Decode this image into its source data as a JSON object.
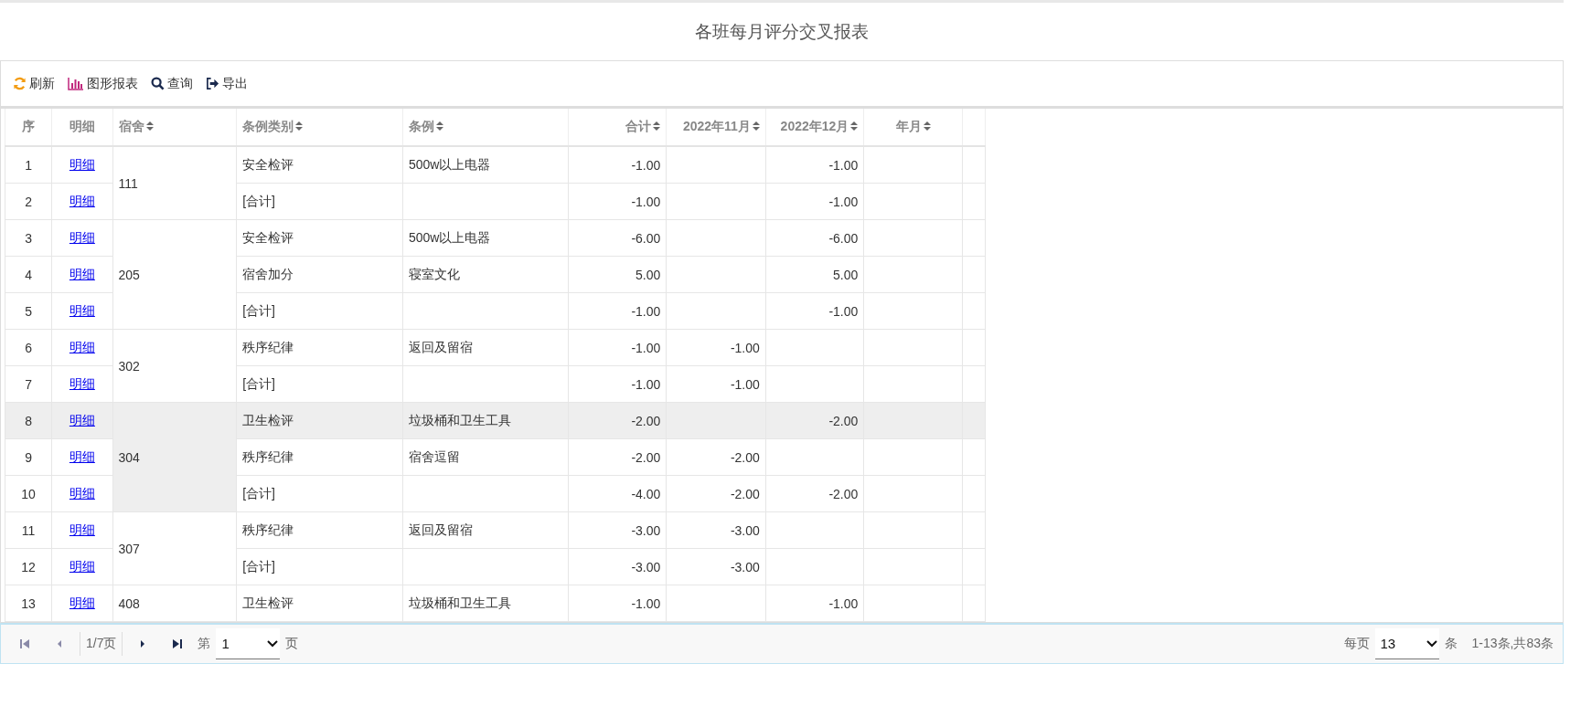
{
  "title": "各班每月评分交叉报表",
  "toolbar": [
    {
      "kind": "refresh",
      "label": "刷新"
    },
    {
      "kind": "chart",
      "label": "图形报表"
    },
    {
      "kind": "search",
      "label": "查询"
    },
    {
      "kind": "export",
      "label": "导出"
    }
  ],
  "columns": [
    {
      "label": "序",
      "sortable": false
    },
    {
      "label": "明细",
      "sortable": false
    },
    {
      "label": "宿舍",
      "sortable": true
    },
    {
      "label": "条例类别",
      "sortable": true
    },
    {
      "label": "条例",
      "sortable": true
    },
    {
      "label": "合计",
      "sortable": true
    },
    {
      "label": "2022年11月",
      "sortable": true
    },
    {
      "label": "2022年12月",
      "sortable": true
    },
    {
      "label": "年月",
      "sortable": true
    }
  ],
  "groups": [
    {
      "dorm": "111",
      "rows": [
        {
          "no": "1",
          "link": "明细",
          "category": "安全检评",
          "rule": "500w以上电器",
          "total": "-1.00",
          "dec": "-1.00",
          "selected": false
        },
        {
          "no": "2",
          "link": "明细",
          "category": "[合计]",
          "total": "-1.00",
          "dec": "-1.00",
          "selected": false
        }
      ]
    },
    {
      "dorm": "205",
      "rows": [
        {
          "no": "3",
          "link": "明细",
          "category": "安全检评",
          "rule": "500w以上电器",
          "total": "-6.00",
          "dec": "-6.00",
          "selected": false
        },
        {
          "no": "4",
          "link": "明细",
          "category": "宿舍加分",
          "rule": "寝室文化",
          "total": "5.00",
          "dec": "5.00",
          "selected": false
        },
        {
          "no": "5",
          "link": "明细",
          "category": "[合计]",
          "total": "-1.00",
          "dec": "-1.00",
          "selected": false
        }
      ]
    },
    {
      "dorm": "302",
      "rows": [
        {
          "no": "6",
          "link": "明细",
          "category": "秩序纪律",
          "rule": "返回及留宿",
          "total": "-1.00",
          "nov": "-1.00",
          "selected": false
        },
        {
          "no": "7",
          "link": "明细",
          "category": "[合计]",
          "total": "-1.00",
          "nov": "-1.00",
          "selected": false
        }
      ]
    },
    {
      "dorm": "304",
      "rows": [
        {
          "no": "8",
          "link": "明细",
          "category": "卫生检评",
          "rule": "垃圾桶和卫生工具",
          "total": "-2.00",
          "dec": "-2.00",
          "selected": true
        },
        {
          "no": "9",
          "link": "明细",
          "category": "秩序纪律",
          "rule": "宿舍逗留",
          "total": "-2.00",
          "nov": "-2.00",
          "selected": false
        },
        {
          "no": "10",
          "link": "明细",
          "category": "[合计]",
          "total": "-4.00",
          "nov": "-2.00",
          "dec": "-2.00",
          "selected": false
        }
      ]
    },
    {
      "dorm": "307",
      "rows": [
        {
          "no": "11",
          "link": "明细",
          "category": "秩序纪律",
          "rule": "返回及留宿",
          "total": "-3.00",
          "nov": "-3.00",
          "selected": false
        },
        {
          "no": "12",
          "link": "明细",
          "category": "[合计]",
          "total": "-3.00",
          "nov": "-3.00",
          "selected": false
        }
      ]
    },
    {
      "dorm": "408",
      "rows": [
        {
          "no": "13",
          "link": "明细",
          "category": "卫生检评",
          "rule": "垃圾桶和卫生工具",
          "total": "-1.00",
          "dec": "-1.00",
          "selected": false
        }
      ]
    }
  ],
  "pager": {
    "page_info": "1/7页",
    "page_prefix": "第",
    "page_value": "1",
    "page_suffix": "页",
    "size_prefix": "每页",
    "size_value": "13",
    "size_suffix": "条",
    "summary": "1-13条,共83条",
    "first_disabled": true,
    "prev_disabled": true
  }
}
